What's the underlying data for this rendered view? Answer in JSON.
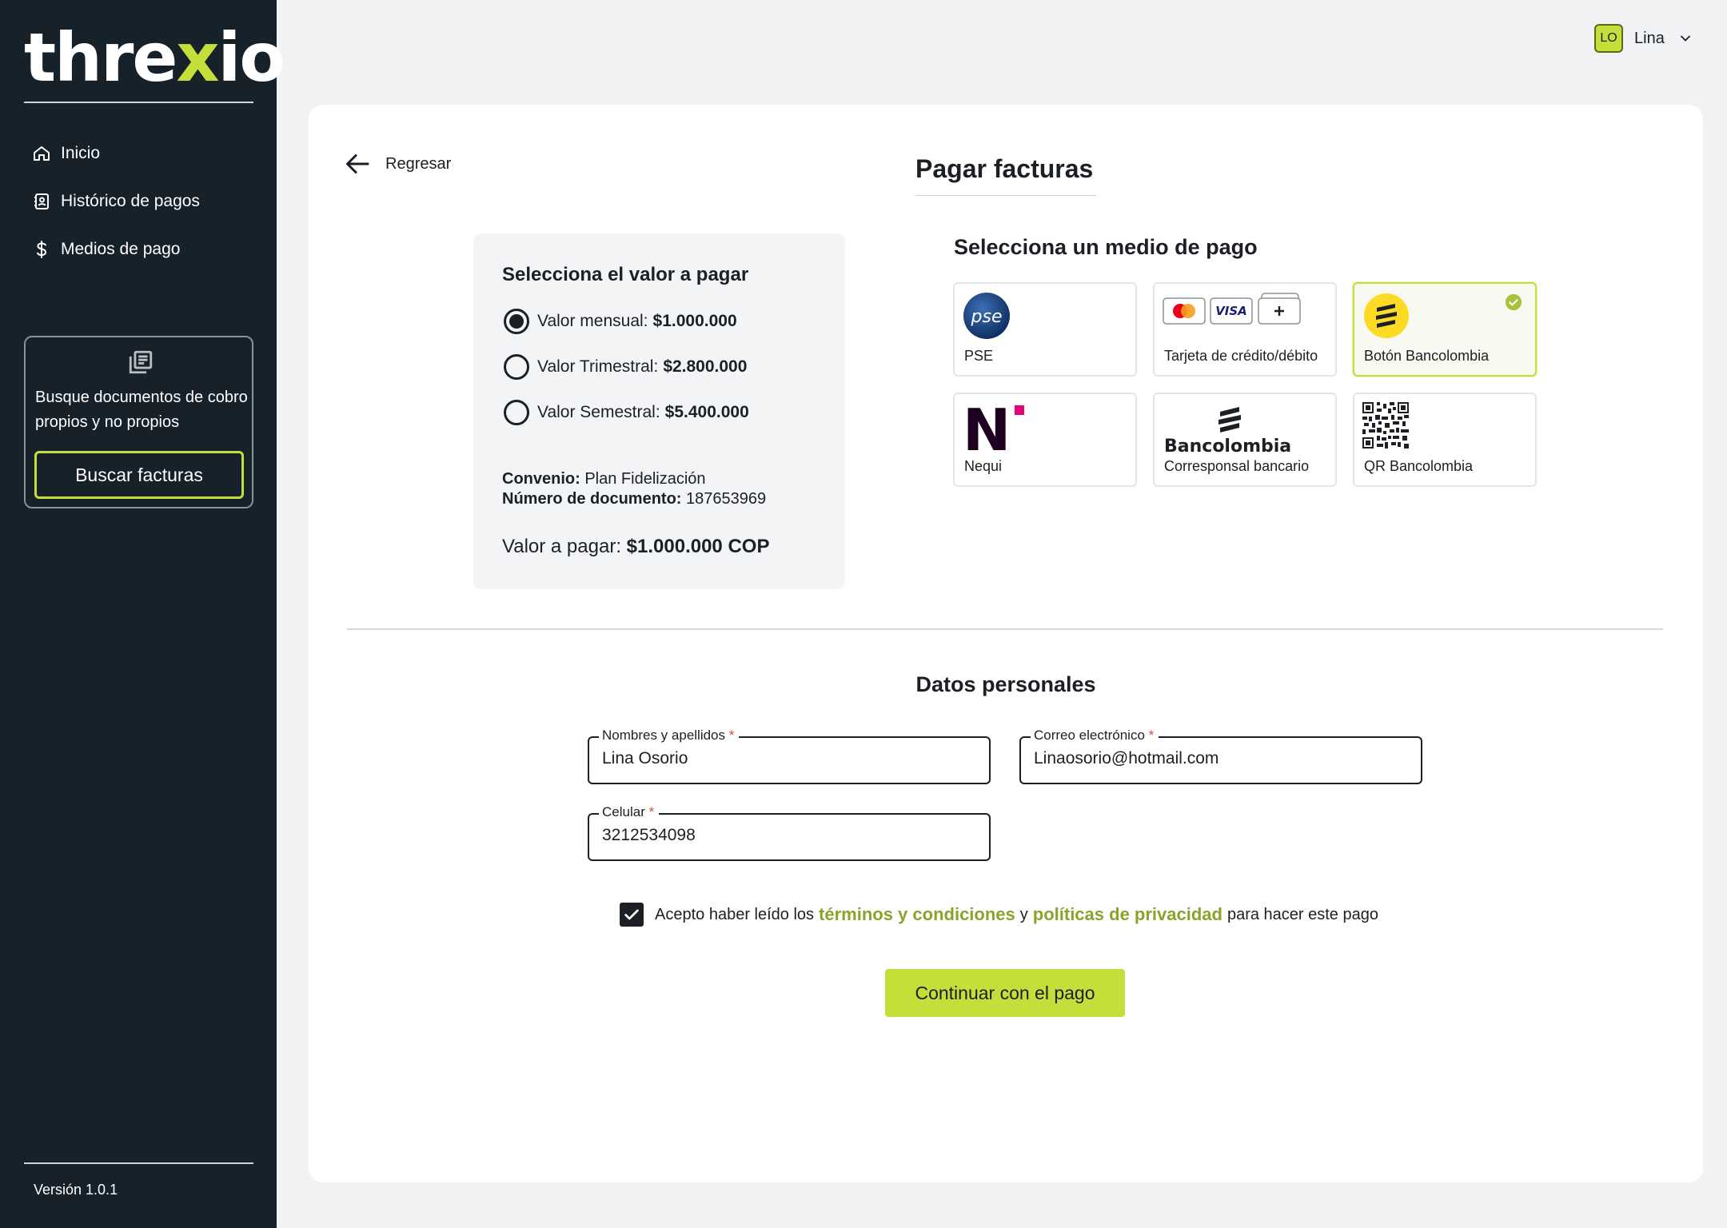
{
  "brand": {
    "logo_a": "thre",
    "logo_x": "x",
    "logo_b": "io",
    "accent": "#c5df3a",
    "sidebar_bg": "#17212a"
  },
  "sidebar": {
    "items": [
      {
        "label": "Inicio",
        "icon": "home-icon"
      },
      {
        "label": "Histórico de pagos",
        "icon": "contact-book-icon"
      },
      {
        "label": "Medios de pago",
        "icon": "dollar-icon"
      }
    ],
    "promo": {
      "icon": "documents-icon",
      "text": "Busque documentos de cobro propios y no propios",
      "button": "Buscar facturas"
    },
    "version": "Versión 1.0.1"
  },
  "user": {
    "initials": "LO",
    "name": "Lina"
  },
  "page": {
    "back_label": "Regresar",
    "title": "Pagar facturas"
  },
  "value_panel": {
    "title": "Selecciona el valor a pagar",
    "options": [
      {
        "label": "Valor mensual:",
        "amount": "$1.000.000",
        "selected": true
      },
      {
        "label": "Valor Trimestral:",
        "amount": "$2.800.000",
        "selected": false
      },
      {
        "label": "Valor Semestral:",
        "amount": "$5.400.000",
        "selected": false
      }
    ],
    "convenio_label": "Convenio:",
    "convenio_value": "Plan Fidelización",
    "doc_label": "Número de documento:",
    "doc_value": "187653969",
    "total_label": "Valor a pagar:",
    "total_value": "$1.000.000 COP"
  },
  "payment_methods": {
    "title": "Selecciona un medio de pago",
    "items": [
      {
        "label": "PSE",
        "icon": "pse-logo",
        "logo_text": "pse"
      },
      {
        "label": "Tarjeta de crédito/débito",
        "icon": "cards-icon",
        "logo_text": "VISA"
      },
      {
        "label": "Botón Bancolombia",
        "icon": "bancolombia-icon",
        "selected": true
      },
      {
        "label": "Nequi",
        "icon": "nequi-logo",
        "logo_text": "N"
      },
      {
        "label": "Corresponsal bancario",
        "icon": "bancolombia-logo",
        "logo_text": "Bancolombia"
      },
      {
        "label": "QR Bancolombia",
        "icon": "qr-code-icon"
      }
    ]
  },
  "personal": {
    "title": "Datos personales",
    "name_label": "Nombres y apellidos",
    "name_value": "Lina Osorio",
    "email_label": "Correo electrónico",
    "email_value": "Linaosorio@hotmail.com",
    "phone_label": "Celular",
    "phone_value": "3212534098",
    "required_mark": "*"
  },
  "agree": {
    "checked": true,
    "t1": "Acepto haber leído los",
    "link1": "términos y condiciones",
    "t2": "y",
    "link2": "políticas de privacidad",
    "t3": "para hacer este pago"
  },
  "cta": "Continuar con el pago"
}
